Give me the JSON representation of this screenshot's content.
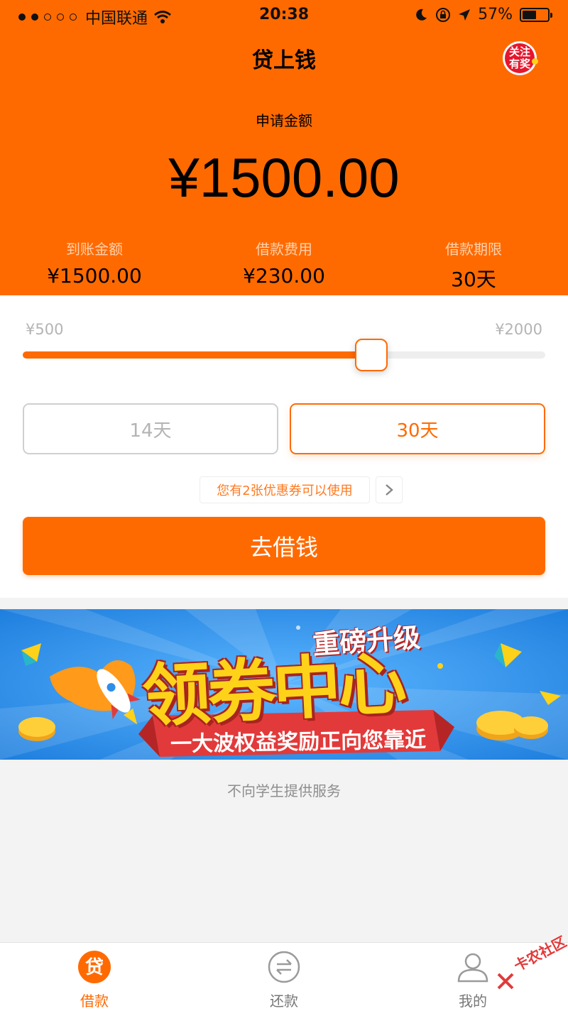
{
  "status_bar": {
    "carrier": "中国联通",
    "time": "20:38",
    "battery": "57%",
    "battery_level": 0.57
  },
  "header": {
    "title": "贷上钱",
    "promo_badge": "关注有奖"
  },
  "loan": {
    "amount_label": "申请金额",
    "amount": "¥1500.00",
    "stats": [
      {
        "label": "到账金额",
        "value": "¥1500.00"
      },
      {
        "label": "借款费用",
        "value": "¥230.00"
      },
      {
        "label": "借款期限",
        "value": "30天"
      }
    ]
  },
  "slider": {
    "min_label": "¥500",
    "max_label": "¥2000",
    "min": 500,
    "max": 2000,
    "value": 1500
  },
  "terms": {
    "options": [
      "14天",
      "30天"
    ],
    "selected": "30天"
  },
  "coupon": {
    "text": "您有2张优惠券可以使用"
  },
  "borrow_button": "去借钱",
  "banner": {
    "top_text": "重磅升级",
    "main_text": "领券中心",
    "ribbon_text": "一大波权益奖励正向您靠近"
  },
  "notice": "不向学生提供服务",
  "tabs": [
    {
      "label": "借款",
      "icon": "loan-icon",
      "active": true
    },
    {
      "label": "还款",
      "icon": "repay-icon",
      "active": false
    },
    {
      "label": "我的",
      "icon": "profile-icon",
      "active": false
    }
  ],
  "watermark": "卡农社区",
  "colors": {
    "accent": "#ff6a00",
    "banner_blue": "#2f8ee8",
    "banner_yellow": "#ffd21a",
    "banner_red": "#e23a3a"
  }
}
